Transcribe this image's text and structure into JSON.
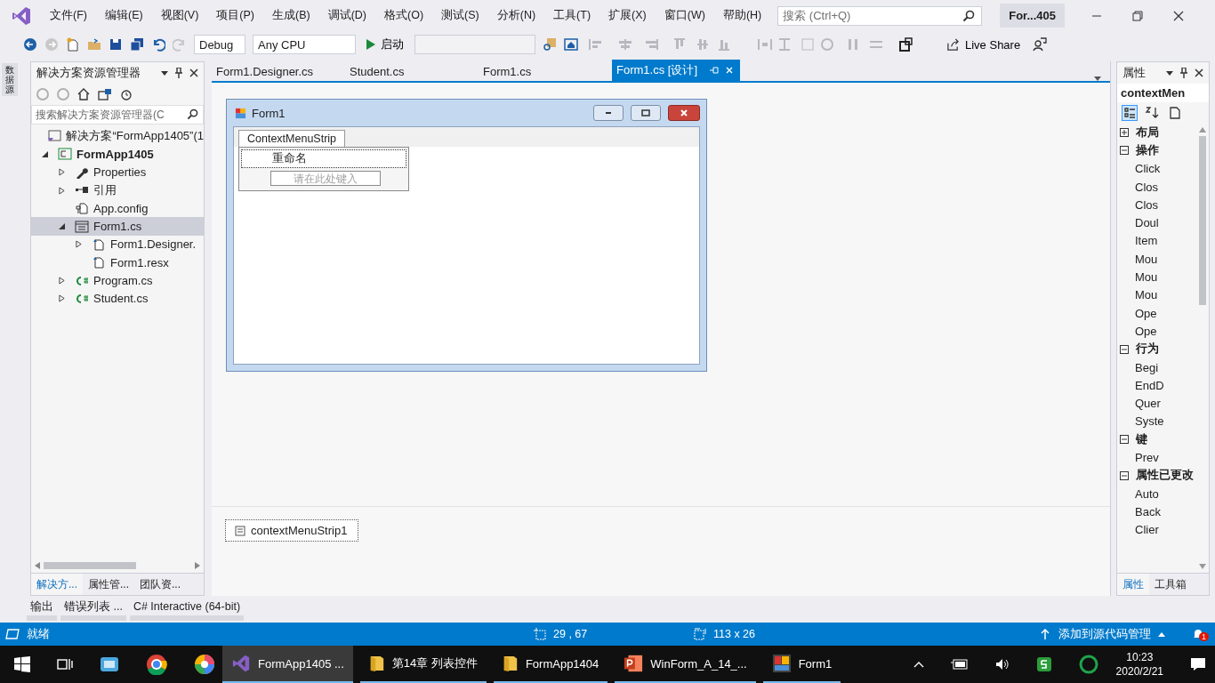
{
  "menu": {
    "items": [
      "文件(F)",
      "编辑(E)",
      "视图(V)",
      "项目(P)",
      "生成(B)",
      "调试(D)",
      "格式(O)",
      "测试(S)",
      "分析(N)",
      "工具(T)",
      "扩展(X)",
      "窗口(W)",
      "帮助(H)"
    ],
    "search_placeholder": "搜索 (Ctrl+Q)",
    "title": "For...405"
  },
  "toolbar": {
    "configuration": "Debug",
    "platform": "Any CPU",
    "start": "启动",
    "live_share": "Live Share"
  },
  "left_strip": {
    "label": "数据源"
  },
  "solution_explorer": {
    "title": "解决方案资源管理器",
    "search_placeholder": "搜索解决方案资源管理器(C",
    "tree": [
      {
        "label": "解决方案“FormApp1405”(1",
        "kind": "solution",
        "selected": false,
        "children": [
          {
            "label": "FormApp1405",
            "kind": "project",
            "expanded": true,
            "selected": false,
            "children": [
              {
                "label": "Properties",
                "kind": "properties",
                "expanded": false,
                "selected": false
              },
              {
                "label": "引用",
                "kind": "references",
                "expanded": false,
                "selected": false
              },
              {
                "label": "App.config",
                "kind": "config",
                "selected": false
              },
              {
                "label": "Form1.cs",
                "kind": "form",
                "expanded": true,
                "selected": true,
                "children": [
                  {
                    "label": "Form1.Designer.",
                    "kind": "file",
                    "expanded": false,
                    "selected": false
                  },
                  {
                    "label": "Form1.resx",
                    "kind": "file",
                    "selected": false
                  }
                ]
              },
              {
                "label": "Program.cs",
                "kind": "cs",
                "expanded": false,
                "selected": false
              },
              {
                "label": "Student.cs",
                "kind": "cs",
                "expanded": false,
                "selected": false
              }
            ]
          }
        ]
      }
    ],
    "tabs": [
      {
        "label": "解决方...",
        "selected": true
      },
      {
        "label": "属性管...",
        "selected": false
      },
      {
        "label": "团队资...",
        "selected": false
      }
    ]
  },
  "document_tabs": [
    {
      "label": "Form1.Designer.cs",
      "selected": false
    },
    {
      "label": "Student.cs",
      "selected": false
    },
    {
      "label": "Form1.cs",
      "selected": false
    },
    {
      "label": "Form1.cs [设计]",
      "selected": true
    }
  ],
  "designer": {
    "form_title": "Form1",
    "menu_strip": "ContextMenuStrip",
    "menu_item": "重命名",
    "new_item": {
      "placeholder": "请在此处键入"
    },
    "component": "contextMenuStrip1"
  },
  "properties": {
    "title": "属性",
    "object": "contextMen",
    "categories": [
      {
        "name": "布局",
        "expanded": false
      },
      {
        "name": "操作",
        "expanded": true,
        "items": [
          "Click",
          "Clos",
          "Clos",
          "Doul",
          "Item",
          "Mou",
          "Mou",
          "Mou",
          "Ope",
          "Ope"
        ]
      },
      {
        "name": "行为",
        "expanded": true,
        "items": [
          "Begi",
          "EndD",
          "Quer",
          "Syste"
        ]
      },
      {
        "name": "键",
        "expanded": true,
        "items": [
          "Prev"
        ]
      },
      {
        "name": "属性已更改",
        "expanded": true,
        "items": [
          "Auto",
          "Back",
          "Clier"
        ]
      }
    ],
    "tabs": [
      {
        "label": "属性",
        "selected": true
      },
      {
        "label": "工具箱",
        "selected": false
      }
    ]
  },
  "bottom_tabs": [
    "输出",
    "错误列表 ...",
    "C# Interactive (64-bit)"
  ],
  "status_bar": {
    "state": "就绪",
    "position": "29 , 67",
    "size": "113 x 26",
    "source_control": "添加到源代码管理",
    "notifications": "1"
  },
  "taskbar": {
    "apps": [
      {
        "label": "FormApp1405 ...",
        "kind": "vs",
        "selected": true
      },
      {
        "label": "第14章 列表控件",
        "kind": "folder",
        "selected": false
      },
      {
        "label": "FormApp1404",
        "kind": "folder",
        "selected": false
      },
      {
        "label": "WinForm_A_14_...",
        "kind": "ppt",
        "selected": false
      },
      {
        "label": "Form1",
        "kind": "form",
        "selected": false
      }
    ],
    "time": "10:23",
    "date": "2020/2/21"
  }
}
